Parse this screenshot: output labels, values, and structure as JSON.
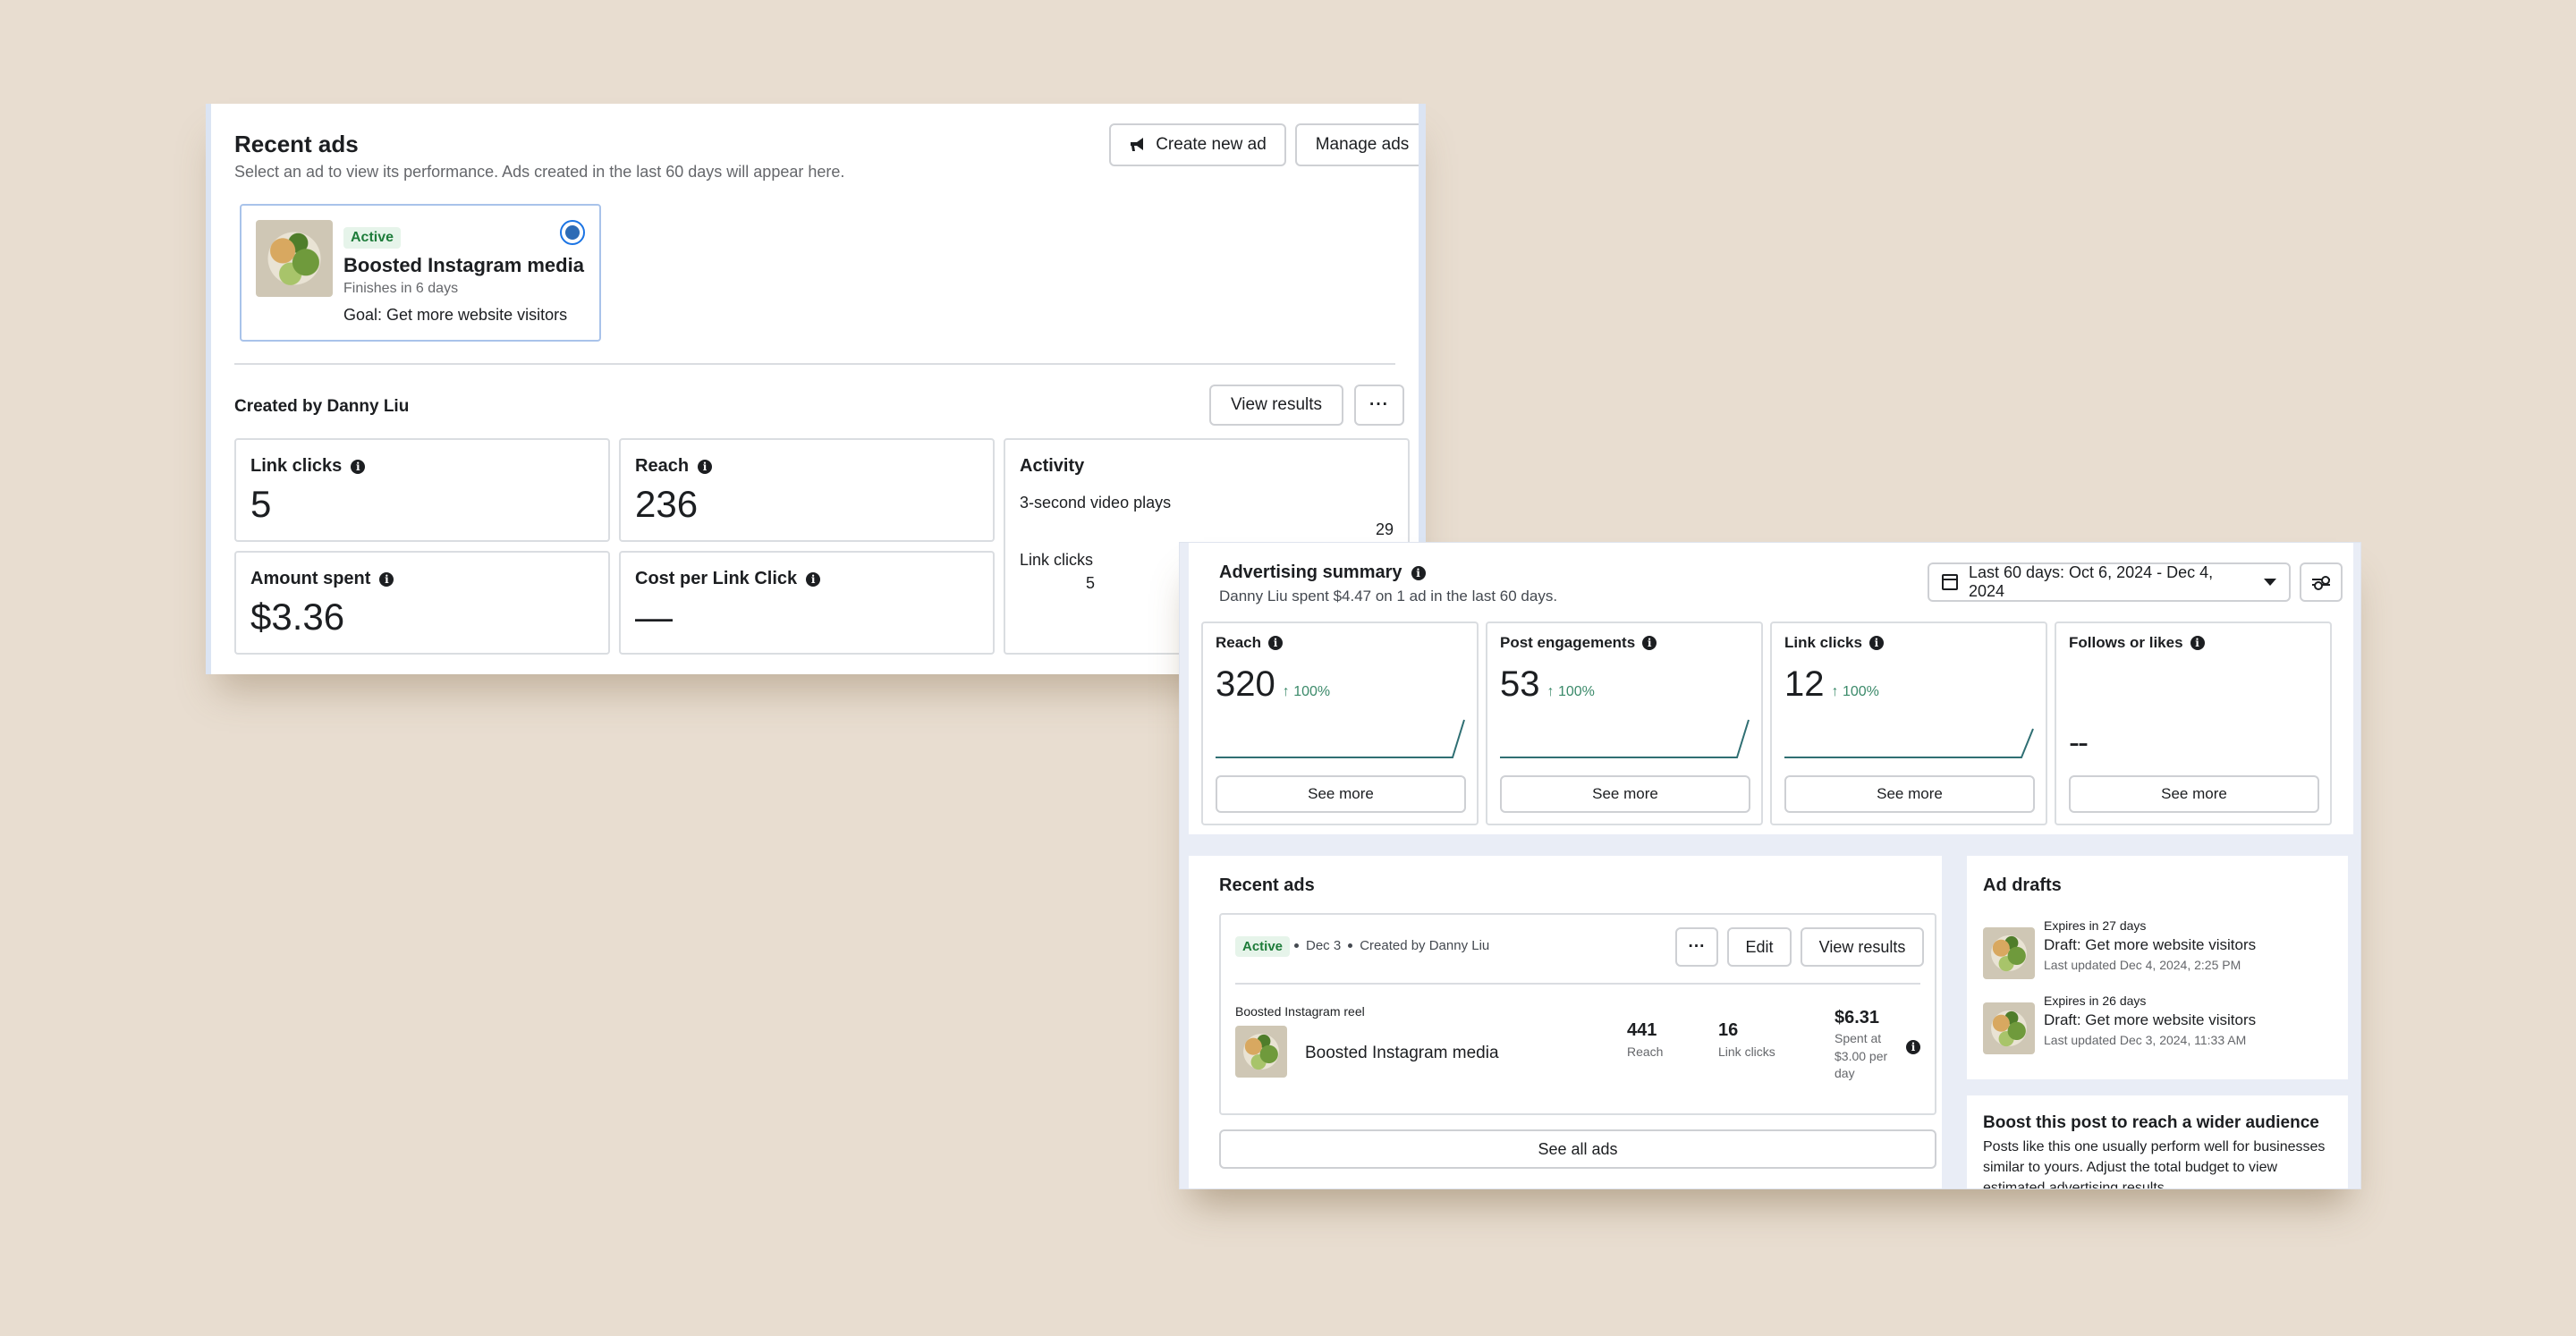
{
  "panel1": {
    "title": "Recent ads",
    "subtitle": "Select an ad to view its performance. Ads created in the last 60 days will appear here.",
    "create_button": "Create new ad",
    "manage_button": "Manage ads",
    "ad_card": {
      "status": "Active",
      "name": "Boosted Instagram media",
      "finishes": "Finishes in 6 days",
      "goal": "Goal: Get more website visitors",
      "selected": true
    },
    "created_by": "Created by Danny Liu",
    "view_results": "View results",
    "more_button": "···",
    "metrics": {
      "link_clicks_label": "Link clicks",
      "link_clicks_value": "5",
      "reach_label": "Reach",
      "reach_value": "236",
      "amount_spent_label": "Amount spent",
      "amount_spent_value": "$3.36",
      "cpc_label": "Cost per Link Click",
      "cpc_value": "—",
      "activity_label": "Activity",
      "activity_row1_label": "3-second video plays",
      "activity_row1_value": "29",
      "activity_row2_label": "Link clicks",
      "activity_row2_value": "5"
    }
  },
  "panel2": {
    "summary_title": "Advertising summary",
    "summary_subtitle": "Danny Liu spent $4.47 on 1 ad in the last 60 days.",
    "date_range": "Last 60 days: Oct 6, 2024 - Dec 4, 2024",
    "stats": [
      {
        "label": "Reach",
        "value": "320",
        "change": "↑ 100%",
        "see_more": "See more"
      },
      {
        "label": "Post engagements",
        "value": "53",
        "change": "↑ 100%",
        "see_more": "See more"
      },
      {
        "label": "Link clicks",
        "value": "12",
        "change": "↑ 100%",
        "see_more": "See more"
      },
      {
        "label": "Follows or likes",
        "value": "--",
        "change": "",
        "see_more": "See more"
      }
    ],
    "recent_ads": {
      "title": "Recent ads",
      "status": "Active",
      "date": "Dec 3",
      "created_by": "Created by Danny Liu",
      "more_button": "···",
      "edit_button": "Edit",
      "view_results_button": "View results",
      "ad_type": "Boosted Instagram reel",
      "ad_name": "Boosted Instagram media",
      "reach_value": "441",
      "reach_label": "Reach",
      "clicks_value": "16",
      "clicks_label": "Link clicks",
      "spent_value": "$6.31",
      "spent_label": "Spent at $3.00 per day",
      "see_all": "See all ads"
    },
    "drafts": {
      "title": "Ad drafts",
      "items": [
        {
          "expires": "Expires in 27 days",
          "name": "Draft: Get more website visitors",
          "updated": "Last updated Dec 4, 2024, 2:25 PM"
        },
        {
          "expires": "Expires in 26 days",
          "name": "Draft: Get more website visitors",
          "updated": "Last updated Dec 3, 2024, 11:33 AM"
        }
      ]
    },
    "boost": {
      "title": "Boost this post to reach a wider audience",
      "text": "Posts like this one usually perform well for businesses similar to yours. Adjust the total budget to view estimated advertising results."
    }
  },
  "colors": {
    "background": "#e8ddd0",
    "active_badge_bg": "#e6f4ea",
    "active_badge_text": "#1e7c3a",
    "selected_border": "#a9c3ea",
    "sparkline": "#2f6f73",
    "change_text": "#3b8a6a"
  }
}
